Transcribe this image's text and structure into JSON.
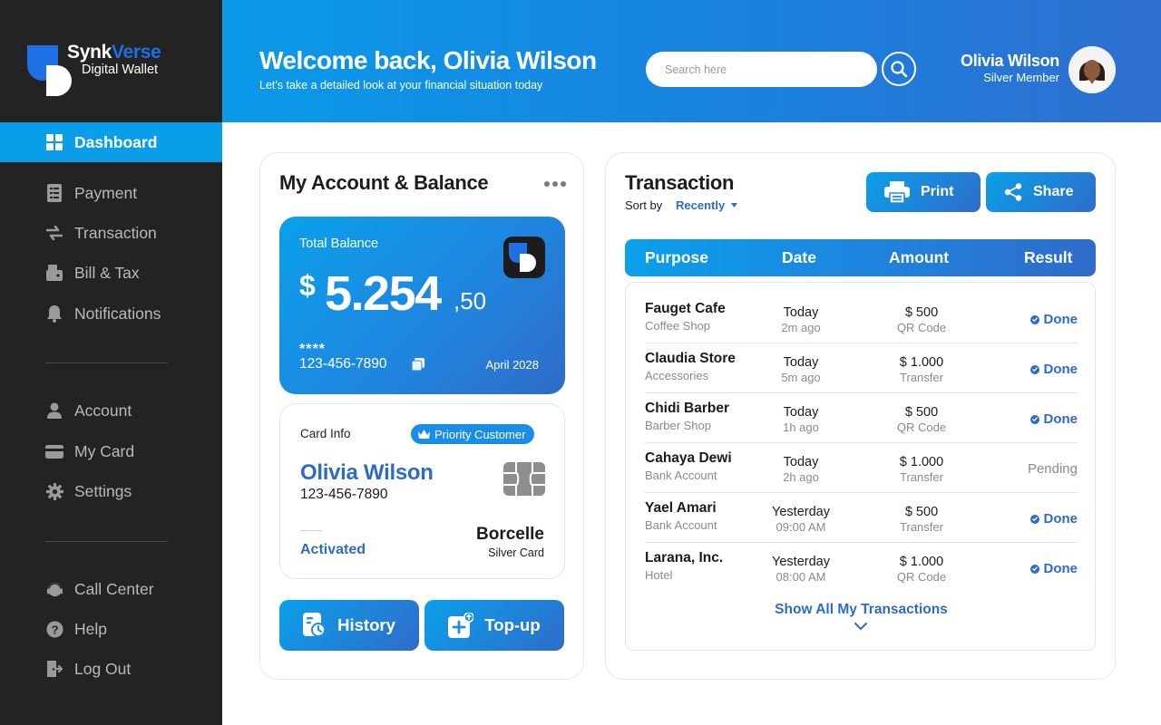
{
  "brand": {
    "name_part1": "Synk",
    "name_part2": "Verse",
    "subtitle": "Digital Wallet"
  },
  "sidebar": {
    "primary": [
      {
        "label": "Dashboard",
        "icon": "grid-icon",
        "active": true
      },
      {
        "label": "Payment",
        "icon": "receipt-icon"
      },
      {
        "label": "Transaction",
        "icon": "transfer-arrows-icon"
      },
      {
        "label": "Bill & Tax",
        "icon": "wallet-icon"
      },
      {
        "label": "Notifications",
        "icon": "bell-icon"
      }
    ],
    "account": [
      {
        "label": "Account",
        "icon": "user-icon"
      },
      {
        "label": "My Card",
        "icon": "card-icon"
      },
      {
        "label": "Settings",
        "icon": "gear-icon"
      }
    ],
    "support": [
      {
        "label": "Call Center",
        "icon": "headset-icon"
      },
      {
        "label": "Help",
        "icon": "help-icon"
      },
      {
        "label": "Log Out",
        "icon": "logout-icon"
      }
    ]
  },
  "header": {
    "welcome": "Welcome back, Olivia Wilson",
    "subtitle": "Let's take a detailed look at your financial situation today",
    "search_placeholder": "Search here",
    "user_name": "Olivia Wilson",
    "user_role": "Silver Member"
  },
  "account_panel": {
    "title": "My Account & Balance",
    "balance": {
      "label": "Total Balance",
      "currency": "$",
      "amount": "5.254",
      "cents": ",50",
      "masked": "****",
      "number": "123-456-7890",
      "expiry": "April 2028"
    },
    "card_info": {
      "label": "Card Info",
      "badge": "Priority Customer",
      "holder": "Olivia Wilson",
      "number": "123-456-7890",
      "status": "Activated",
      "issuer": "Borcelle",
      "tier": "Silver Card"
    },
    "actions": {
      "history": "History",
      "topup": "Top-up"
    }
  },
  "transactions": {
    "title": "Transaction",
    "sort_label": "Sort by",
    "sort_value": "Recently",
    "print": "Print",
    "share": "Share",
    "columns": {
      "purpose": "Purpose",
      "date": "Date",
      "amount": "Amount",
      "result": "Result"
    },
    "rows": [
      {
        "purpose": "Fauget Cafe",
        "category": "Coffee Shop",
        "date": "Today",
        "time": "2m ago",
        "amount": "$ 500",
        "method": "QR Code",
        "result": "Done",
        "status": "done"
      },
      {
        "purpose": "Claudia Store",
        "category": "Accessories",
        "date": "Today",
        "time": "5m ago",
        "amount": "$ 1.000",
        "method": "Transfer",
        "result": "Done",
        "status": "done"
      },
      {
        "purpose": "Chidi Barber",
        "category": "Barber Shop",
        "date": "Today",
        "time": "1h ago",
        "amount": "$ 500",
        "method": "QR Code",
        "result": "Done",
        "status": "done"
      },
      {
        "purpose": "Cahaya Dewi",
        "category": "Bank Account",
        "date": "Today",
        "time": "2h ago",
        "amount": "$ 1.000",
        "method": "Transfer",
        "result": "Pending",
        "status": "pending"
      },
      {
        "purpose": "Yael Amari",
        "category": "Bank Account",
        "date": "Yesterday",
        "time": "09:00 AM",
        "amount": "$ 500",
        "method": "Transfer",
        "result": "Done",
        "status": "done"
      },
      {
        "purpose": "Larana, Inc.",
        "category": "Hotel",
        "date": "Yesterday",
        "time": "08:00 AM",
        "amount": "$ 1.000",
        "method": "QR Code",
        "result": "Done",
        "status": "done"
      }
    ],
    "show_all": "Show All My Transactions"
  },
  "colors": {
    "accent": "#0b9ee8",
    "brand_blue": "#2d6cc5",
    "sidebar_bg": "#232323",
    "pending": "#8a8a8a"
  }
}
